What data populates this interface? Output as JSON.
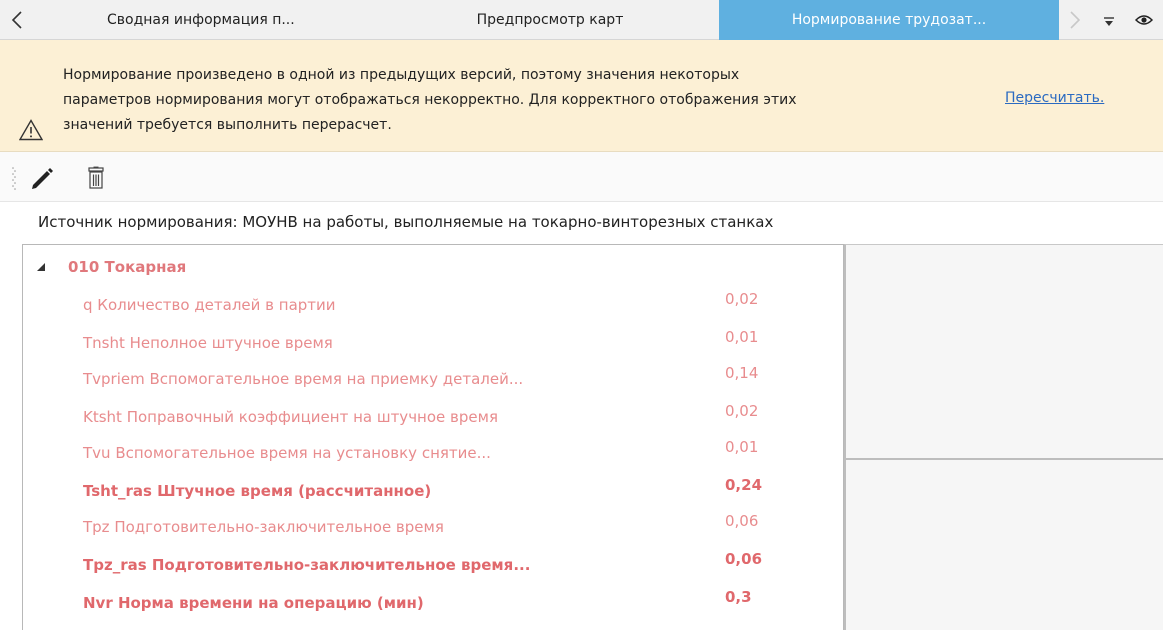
{
  "tabs": {
    "items": [
      {
        "label": "Сводная информация п..."
      },
      {
        "label": "Предпросмотр карт"
      },
      {
        "label": "Нормирование трудозат..."
      }
    ]
  },
  "banner": {
    "lines": [
      "Нормирование произведено в одной из предыдущих версий, поэтому значения некоторых",
      "параметров нормирования могут отображаться некорректно. Для корректного отображения этих",
      "значений требуется выполнить перерасчет."
    ],
    "action_label": "Пересчитать."
  },
  "source": {
    "text": "Источник нормирования: МОУНВ на работы, выполняемые на токарно-винторезных станках"
  },
  "tree": {
    "group_label": "010 Токарная",
    "rows": [
      {
        "label": "q Количество деталей в партии",
        "value": "0,02",
        "bold": false
      },
      {
        "label": "Tnsht Неполное штучное время",
        "value": "0,01",
        "bold": false
      },
      {
        "label": "Tvpriem Вспомогательное время на приемку деталей...",
        "value": "0,14",
        "bold": false
      },
      {
        "label": "Ktsht Поправочный коэффициент на штучное время",
        "value": "0,02",
        "bold": false
      },
      {
        "label": "Tvu Вспомогательное время на установку снятие...",
        "value": "0,01",
        "bold": false
      },
      {
        "label": "Tsht_ras Штучное время (рассчитанное)",
        "value": "0,24",
        "bold": true
      },
      {
        "label": "Tpz Подготовительно-заключительное время",
        "value": "0,06",
        "bold": false
      },
      {
        "label": "Tpz_ras Подготовительно-заключительное время...",
        "value": "0,06",
        "bold": true
      },
      {
        "label": "Nvr Норма времени на операцию (мин)",
        "value": "0,3",
        "bold": true
      }
    ]
  },
  "colors": {
    "active_tab": "#5fb0e0",
    "banner_bg": "#fcf0d5",
    "row_text": "#e88c8e",
    "row_text_bold": "#e0686c",
    "link": "#2a6ac1"
  },
  "icons": {
    "tab_prev": "chevron-left-icon",
    "tab_next": "chevron-right-icon",
    "tab_dropdown": "dropdown-icon",
    "tab_eye": "eye-icon",
    "warning": "warning-icon",
    "edit": "pencil-icon",
    "delete": "trash-icon",
    "expand": "expand-triangle-icon"
  }
}
